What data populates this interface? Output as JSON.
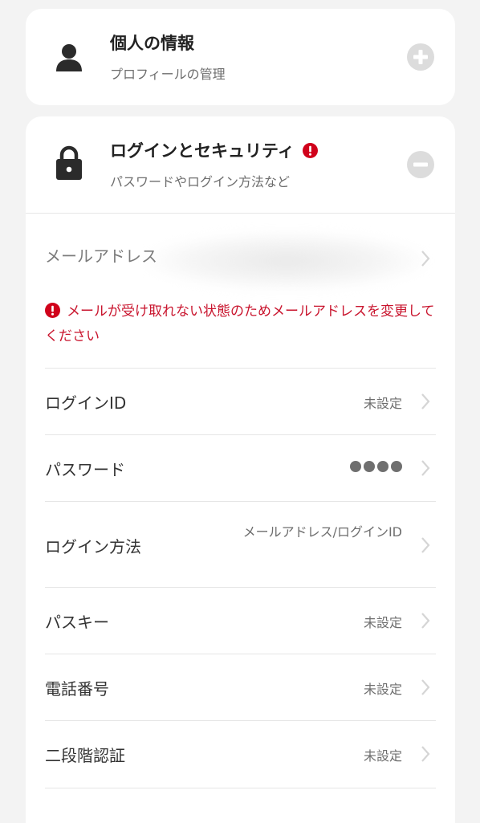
{
  "personal_card": {
    "title": "個人の情報",
    "subtitle": "プロフィールの管理",
    "icon": "person-icon",
    "toggle_icon": "plus-icon"
  },
  "security_card": {
    "title": "ログインとセキュリティ",
    "subtitle": "パスワードやログイン方法など",
    "icon": "lock-icon",
    "alert_icon": "alert-icon",
    "toggle_icon": "minus-icon",
    "email": {
      "label": "メールアドレス"
    },
    "error_message": "メールが受け取れない状態のためメールアドレスを変更してください",
    "rows": [
      {
        "label": "ログインID",
        "value": "未設定"
      },
      {
        "label": "パスワード",
        "value": "●●●●"
      },
      {
        "label": "ログイン方法",
        "value": "メールアドレス/ログインID"
      },
      {
        "label": "パスキー",
        "value": "未設定"
      },
      {
        "label": "電話番号",
        "value": "未設定"
      },
      {
        "label": "二段階認証",
        "value": "未設定"
      }
    ]
  },
  "colors": {
    "background": "#f3f3f3",
    "card": "#ffffff",
    "alert_red": "#d0021b",
    "error_text": "#c9152e",
    "icon_dark": "#2b2b2b",
    "toggle_grey": "#dcdcdc"
  }
}
